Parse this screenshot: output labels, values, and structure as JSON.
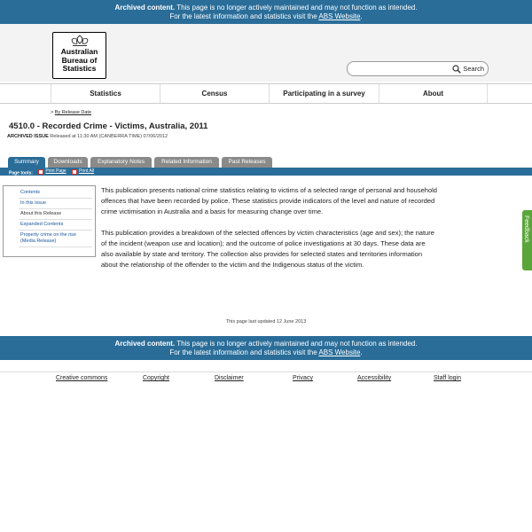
{
  "archived_notice": {
    "label": "Archived content.",
    "message": "This page is no longer actively maintained and may not function as intended.",
    "line2_prefix": "For the latest information and statistics visit the",
    "link_text": "ABS Website",
    "line2_suffix": "."
  },
  "logo": {
    "text_line1": "Australian",
    "text_line2": "Bureau of",
    "text_line3": "Statistics"
  },
  "search": {
    "button_label": "Search",
    "placeholder": ""
  },
  "nav": {
    "items": [
      "Statistics",
      "Census",
      "Participating in a survey",
      "About"
    ]
  },
  "breadcrumb": {
    "separator": ">",
    "link": "By Release Date"
  },
  "page": {
    "title": "4510.0 - Recorded Crime - Victims, Australia, 2011",
    "issue_label": "ARCHIVED ISSUE",
    "issue_text": "Released at 11:30 AM (CANBERRA TIME) 07/06/2012"
  },
  "tabs": [
    "Summary",
    "Downloads",
    "Explanatory Notes",
    "Related Information",
    "Past Releases"
  ],
  "page_tools": {
    "label": "Page tools:",
    "print_page": "Print Page",
    "print_all": "Print All"
  },
  "sidebar": {
    "items": [
      "Contents",
      "In this issue",
      "About this Release",
      "Expanded Contents",
      "Property crime on the rise (Media Release)"
    ]
  },
  "content": {
    "paragraph1": "This publication presents national crime statistics relating to victims of a selected range of personal and household offences that have been recorded by police. These statistics provide indicators of the level and nature of recorded crime victimisation in Australia and a basis for measuring change over time.",
    "paragraph2": "This publication provides a breakdown of the selected offences by victim characteristics (age and sex); the nature of the incident (weapon use and location); and the outcome of police investigations at 30 days. These data are also available by state and territory. The collection also provides for selected states and territories information about the relationship of the offender to the victim and the Indigenous status of the victim."
  },
  "last_updated": "This page last updated 12 June 2013",
  "footer": {
    "links": [
      "Creative commons",
      "Copyright",
      "Disclaimer",
      "Privacy",
      "Accessibility",
      "Staff login"
    ]
  },
  "feedback": {
    "label": "Feedback"
  },
  "colors": {
    "brand_blue": "#2a6d99",
    "tab_grey": "#8a8a8a",
    "feedback_green": "#5aa53a"
  }
}
